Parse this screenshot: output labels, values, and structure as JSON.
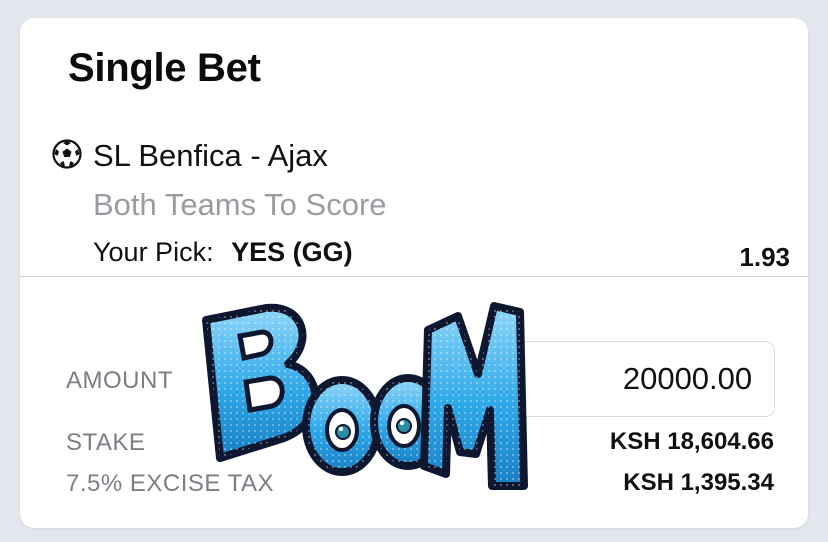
{
  "bet_slip": {
    "title": "Single Bet",
    "sport_icon": "soccer-ball-icon",
    "match": "SL Benfica - Ajax",
    "market": "Both Teams To Score",
    "pick_label": "Your Pick:",
    "pick_value": "YES (GG)",
    "odds": "1.93"
  },
  "amount": {
    "label": "AMOUNT",
    "value": "20000.00",
    "increment_label": "+"
  },
  "summary": {
    "stake_label": "STAKE",
    "stake_value": "KSH 18,604.66",
    "tax_label": "7.5% EXCISE TAX",
    "tax_value": "KSH 1,395.34"
  },
  "overlay": {
    "sticker": "BOOM"
  },
  "colors": {
    "background": "#e4e6ee",
    "card": "#ffffff",
    "muted_text": "#9a9ca2",
    "label_text": "#7c7e85",
    "boom_fill": "#2ea8e8",
    "boom_outline": "#0d1730"
  }
}
